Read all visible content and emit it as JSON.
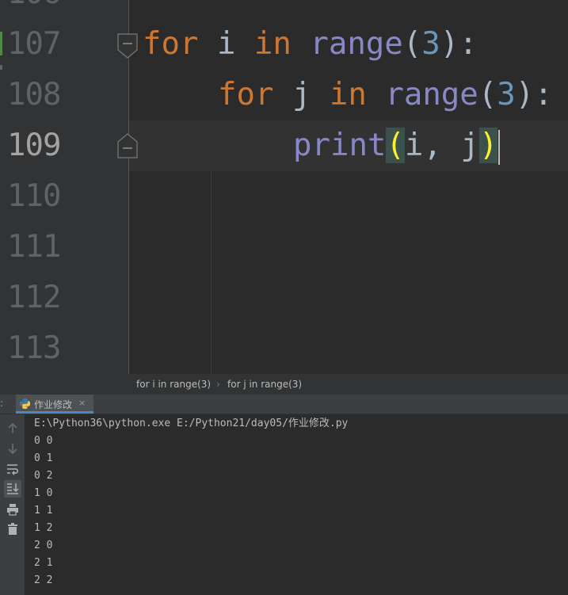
{
  "editor": {
    "partial_line_top": "106",
    "lines": [
      {
        "number": "107"
      },
      {
        "number": "108"
      },
      {
        "number": "109"
      },
      {
        "number": "110"
      },
      {
        "number": "111"
      },
      {
        "number": "112"
      },
      {
        "number": "113"
      }
    ],
    "code": {
      "l107": {
        "kw1": "for",
        "var": "i",
        "kw2": "in",
        "fn": "range",
        "open": "(",
        "num": "3",
        "close": "):"
      },
      "l108": {
        "kw1": "for",
        "var": "j",
        "kw2": "in",
        "fn": "range",
        "open": "(",
        "num": "3",
        "close": "):"
      },
      "l109": {
        "fn": "print",
        "open": "(",
        "args": "i, j",
        "close": ")"
      }
    },
    "colors": {
      "keyword": "#cc7832",
      "builtin": "#8888c6",
      "number": "#6897bb",
      "text": "#a9b7c6",
      "brace_match": "#ffef28"
    }
  },
  "breadcrumb": {
    "items": [
      "for i in range(3)",
      "for j in range(3)"
    ],
    "separator": "›"
  },
  "run_panel": {
    "tab_label": "作业修改",
    "tab_close": "×",
    "tab_icon": "python-icon",
    "toolbar_icons": [
      "arrow-up-icon",
      "arrow-down-icon",
      "soft-wrap-icon",
      "scroll-to-end-icon",
      "print-icon",
      "trash-icon"
    ],
    "command": "E:\\Python36\\python.exe E:/Python21/day05/作业修改.py",
    "output": [
      "0 0",
      "0 1",
      "0 2",
      "1 0",
      "1 1",
      "1 2",
      "2 0",
      "2 1",
      "2 2"
    ]
  }
}
